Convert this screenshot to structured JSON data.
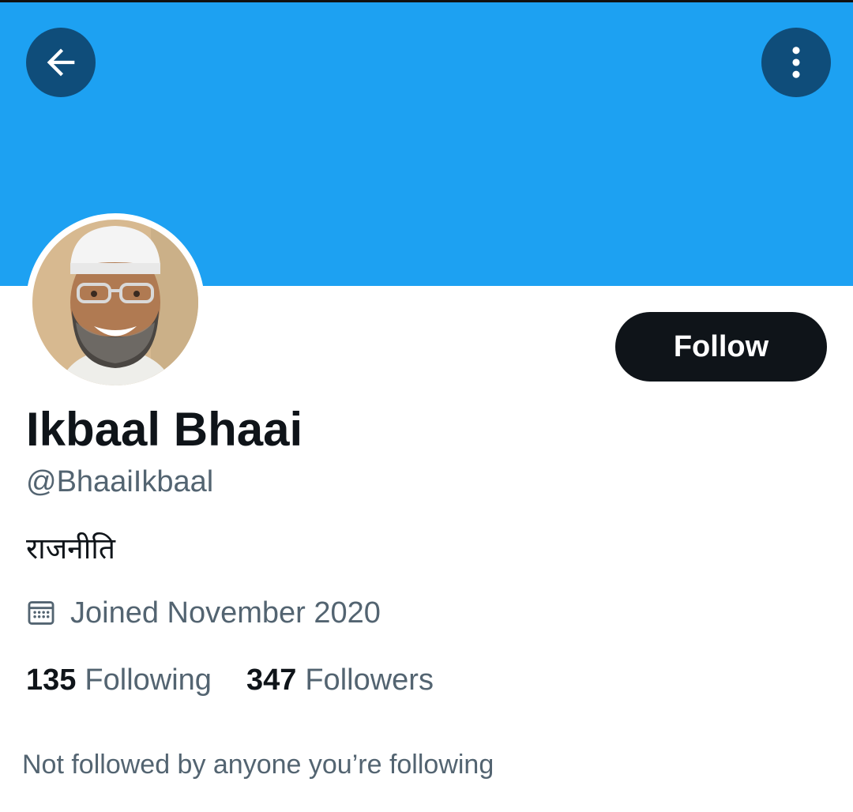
{
  "header": {
    "back_icon": "arrow-left-icon",
    "more_icon": "more-vertical-icon",
    "banner_color": "#1da1f2",
    "button_color": "#0f4d7a"
  },
  "profile": {
    "avatar_icon": "avatar",
    "display_name": "Ikbaal Bhaai",
    "handle": "@BhaaiIkbaal",
    "bio": "राजनीति",
    "joined_icon": "calendar-icon",
    "joined": "Joined November 2020"
  },
  "actions": {
    "follow_label": "Follow",
    "follow_color": "#0f1419"
  },
  "stats": {
    "following_count": "135",
    "following_label": "Following",
    "followers_count": "347",
    "followers_label": "Followers"
  },
  "footer": {
    "not_followed_text": "Not followed by anyone you’re following"
  },
  "colors": {
    "primary_text": "#0f1419",
    "secondary_text": "#536471"
  }
}
